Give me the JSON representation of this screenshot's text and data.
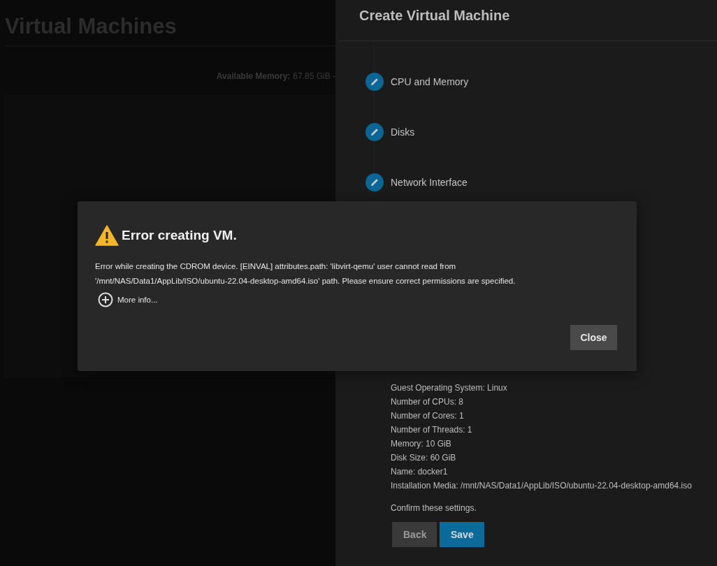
{
  "page": {
    "title": "Virtual Machines",
    "memory_label": "Available Memory:",
    "memory_value": "67.85 GiB -"
  },
  "wizard": {
    "title": "Create Virtual Machine",
    "steps": [
      {
        "label": "CPU and Memory"
      },
      {
        "label": "Disks"
      },
      {
        "label": "Network Interface"
      }
    ],
    "summary": [
      "Guest Operating System: Linux",
      "Number of CPUs: 8",
      "Number of Cores: 1",
      "Number of Threads: 1",
      "Memory: 10 GiB",
      "Disk Size: 60 GiB",
      "Name: docker1",
      "Installation Media: /mnt/NAS/Data1/AppLib/ISO/ubuntu-22.04-desktop-amd64.iso"
    ],
    "confirm": "Confirm these settings.",
    "buttons": [
      {
        "label": "Back",
        "kind": "secondary"
      },
      {
        "label": "Save",
        "kind": "primary"
      }
    ]
  },
  "dialog": {
    "title": "Error creating VM.",
    "message": "Error while creating the CDROM device. [EINVAL] attributes.path: 'libvirt-qemu' user cannot read from '/mnt/NAS/Data1/AppLib/ISO/ubuntu-22.04-desktop-amd64.iso' path. Please ensure correct permissions are specified.",
    "more_info": "More info...",
    "close": "Close"
  }
}
